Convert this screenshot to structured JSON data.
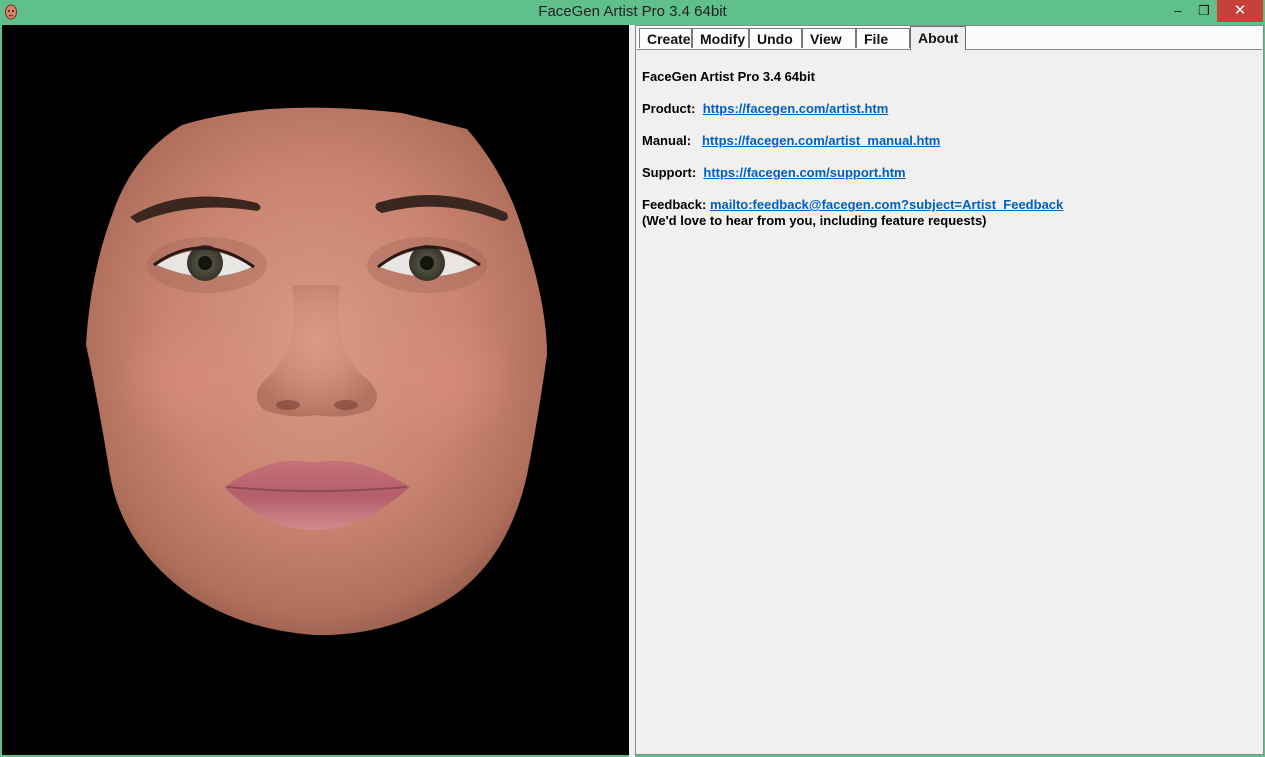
{
  "window": {
    "title": "FaceGen Artist Pro 3.4 64bit",
    "minimize_glyph": "–",
    "maximize_glyph": "❐",
    "close_glyph": "✕"
  },
  "tabs": [
    {
      "label": "Create"
    },
    {
      "label": "Modify"
    },
    {
      "label": "Undo"
    },
    {
      "label": "View"
    },
    {
      "label": "File"
    },
    {
      "label": "About",
      "active": true
    }
  ],
  "about": {
    "app_name": "FaceGen Artist Pro 3.4 64bit",
    "product_label": "Product:",
    "product_link": "https://facegen.com/artist.htm",
    "manual_label": "Manual:",
    "manual_link": "https://facegen.com/artist_manual.htm",
    "support_label": "Support:",
    "support_link": "https://facegen.com/support.htm",
    "feedback_label": "Feedback:",
    "feedback_link": "mailto:feedback@facegen.com?subject=Artist_Feedback",
    "feedback_note": "(We'd love to hear from you, including feature requests)"
  },
  "colors": {
    "titlebar": "#5fc08c",
    "close_button": "#c7403a",
    "viewport_bg": "#000000",
    "link": "#0060c0"
  }
}
